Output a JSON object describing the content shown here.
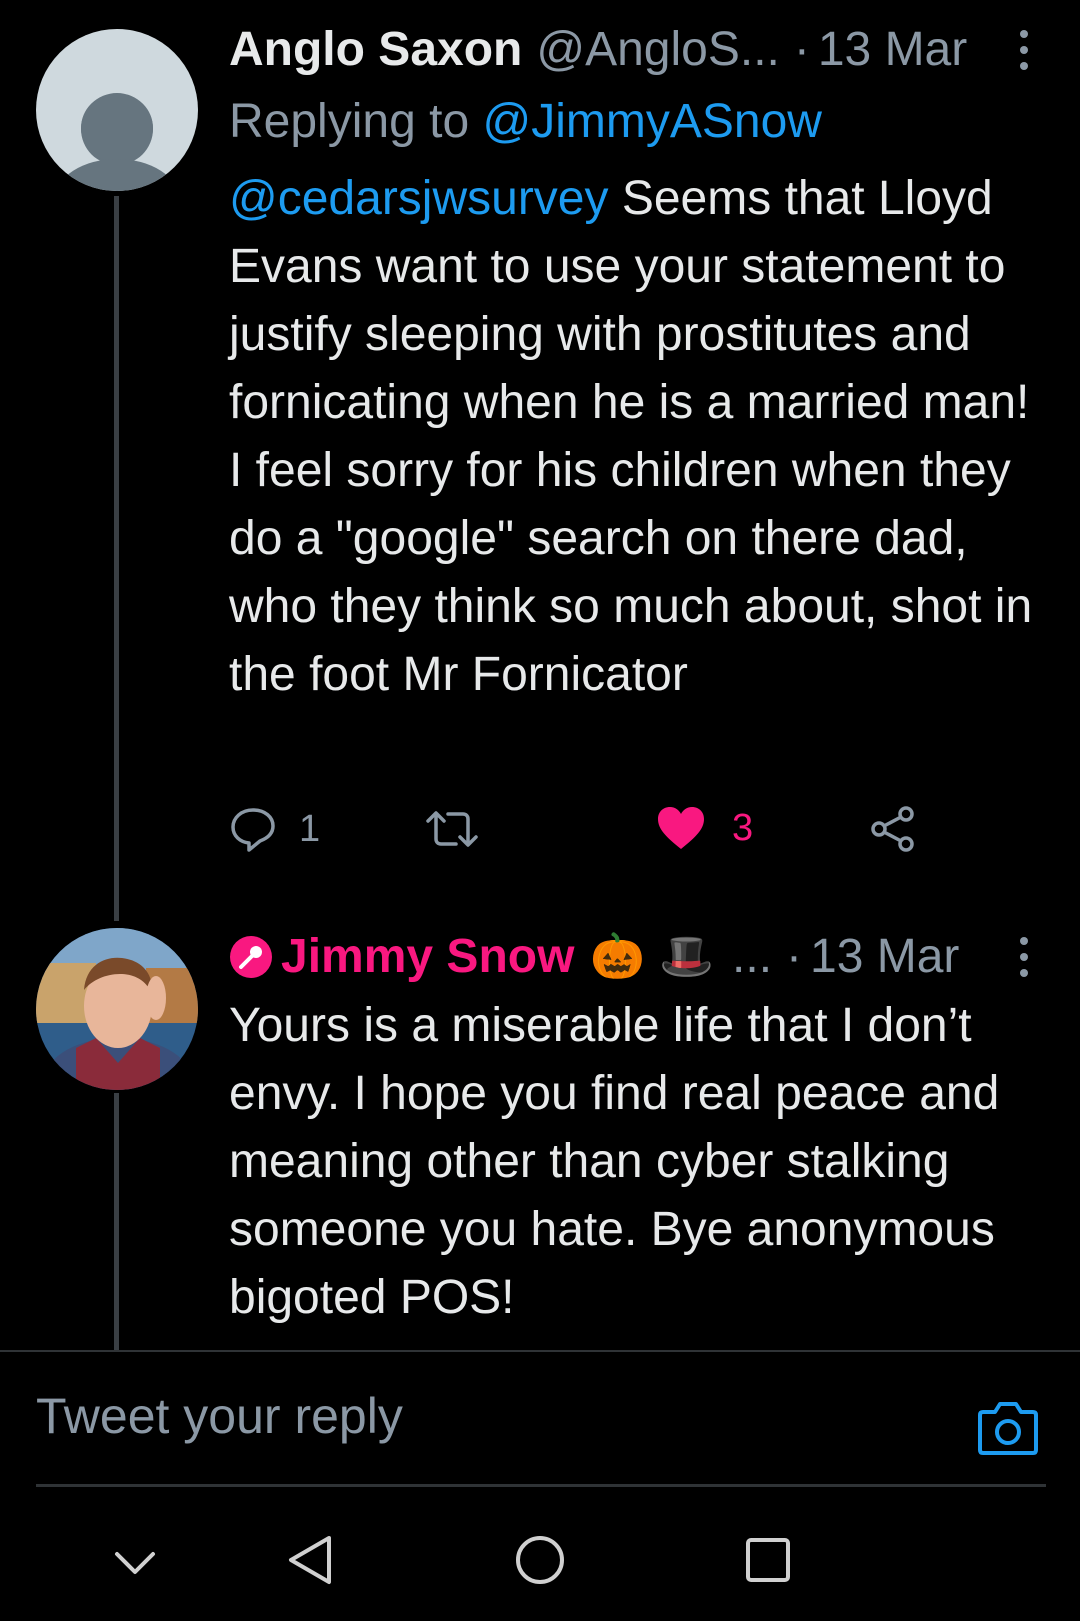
{
  "tweets": [
    {
      "name": "Anglo Saxon",
      "handle": "@AngloS...",
      "separator": "·",
      "date": "13 Mar",
      "replying_prefix": "Replying to ",
      "replying_to": "@JimmyASnow",
      "mention": "@cedarsjwsurvey",
      "text": " Seems that Lloyd Evans want to use your statement to justify sleeping with prostitutes and fornicating when he is a married man! I feel sorry for his children when they do a \"google\" search on there dad, who they think so much about, shot in the foot Mr Fornicator",
      "reply_count": "1",
      "like_count": "3",
      "avatar_icon": "default-profile-icon"
    },
    {
      "name": "Jimmy Snow",
      "emoji_1": "🎃",
      "emoji_2": "🎩",
      "truncation": "...",
      "separator": "·",
      "date": "13 Mar",
      "text": "Yours is a miserable life that I don’t envy. I hope you find real peace and meaning other than cyber stalking someone you hate. Bye anonymous bigoted POS!",
      "name_icon": "microphone-icon"
    }
  ],
  "reply_box": {
    "placeholder": "Tweet your reply"
  },
  "colors": {
    "background": "#000000",
    "text": "#e7e9ea",
    "muted": "#8b98a5",
    "link": "#1d9bf0",
    "like": "#f91880",
    "divider": "#2f3336"
  },
  "nav_icons": [
    "chevron-down-icon",
    "back-icon",
    "home-icon",
    "recents-icon"
  ]
}
